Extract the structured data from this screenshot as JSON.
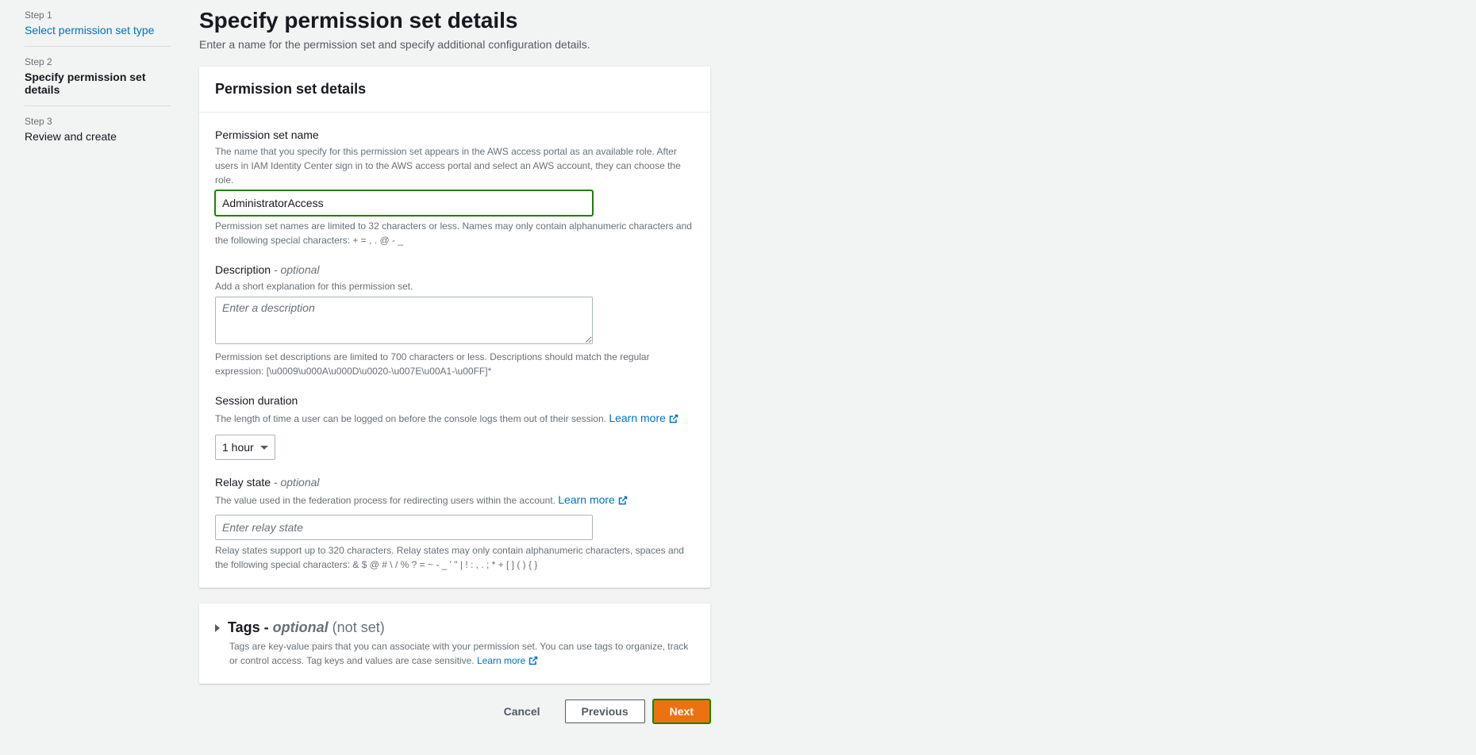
{
  "steps": {
    "s1_num": "Step 1",
    "s1_title": "Select permission set type",
    "s2_num": "Step 2",
    "s2_title": "Specify permission set details",
    "s3_num": "Step 3",
    "s3_title": "Review and create"
  },
  "header": {
    "title": "Specify permission set details",
    "subtitle": "Enter a name for the permission set and specify additional configuration details."
  },
  "panel1": {
    "title": "Permission set details",
    "name_label": "Permission set name",
    "name_hint": "The name that you specify for this permission set appears in the AWS access portal as an available role. After users in IAM Identity Center sign in to the AWS access portal and select an AWS account, they can choose the role.",
    "name_value": "AdministratorAccess",
    "name_constraint": "Permission set names are limited to 32 characters or less. Names may only contain alphanumeric characters and the following special characters: + = , . @ - _",
    "desc_label": "Description",
    "optional": " - optional",
    "desc_hint": "Add a short explanation for this permission set.",
    "desc_placeholder": "Enter a description",
    "desc_constraint": "Permission set descriptions are limited to 700 characters or less. Descriptions should match the regular expression: [\\u0009\\u000A\\u000D\\u0020-\\u007E\\u00A1-\\u00FF]*",
    "session_label": "Session duration",
    "session_hint": "The length of time a user can be logged on before the console logs them out of their session.  ",
    "session_value": "1 hour",
    "learn_more": "Learn more",
    "relay_label": "Relay state",
    "relay_hint": "The value used in the federation process for redirecting users within the account. ",
    "relay_placeholder": "Enter relay state",
    "relay_constraint": "Relay states support up to 320 characters. Relay states may only contain alphanumeric characters, spaces and the following special characters: & $ @ # \\ / % ? = ~ - _ ' \" | ! : , . ; * + [ ] ( ) { }"
  },
  "tags": {
    "title": "Tags - ",
    "optional": "optional",
    "notset": " (not set)",
    "desc": "Tags are key-value pairs that you can associate with your permission set. You can use tags to organize, track or control access. Tag keys and values are case sensitive. ",
    "learn_more": "Learn more"
  },
  "buttons": {
    "cancel": "Cancel",
    "previous": "Previous",
    "next": "Next"
  }
}
